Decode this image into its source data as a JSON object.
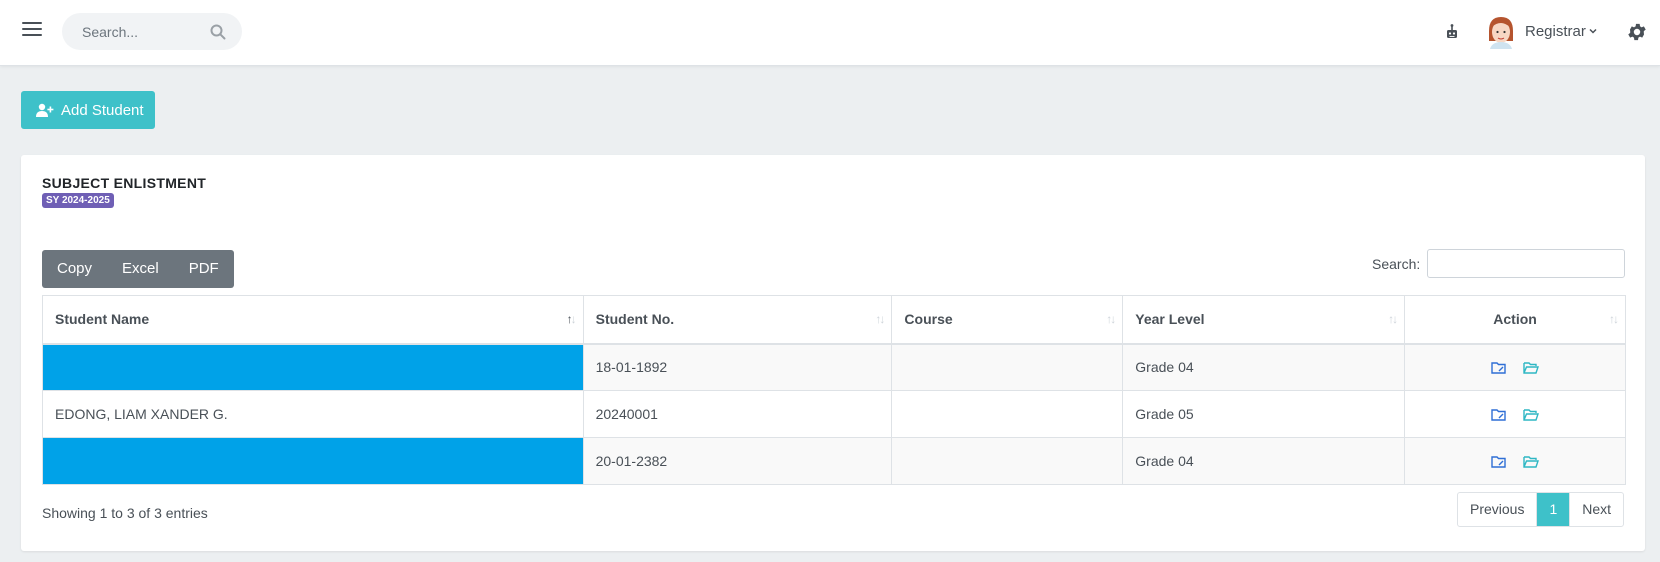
{
  "header": {
    "search_placeholder": "Search...",
    "user_name": "Registrar"
  },
  "actions": {
    "add_student": "Add Student"
  },
  "card": {
    "title": "SUBJECT ENLISTMENT",
    "badge": "SY 2024-2025",
    "export_buttons": [
      "Copy",
      "Excel",
      "PDF"
    ],
    "search_label": "Search:"
  },
  "table": {
    "columns": [
      "Student Name",
      "Student No.",
      "Course",
      "Year Level",
      "Action"
    ],
    "rows": [
      {
        "name": "",
        "student_no": "18-01-1892",
        "course": "",
        "year_level": "Grade 04"
      },
      {
        "name": "EDONG, LIAM XANDER G.",
        "student_no": "20240001",
        "course": "",
        "year_level": "Grade 05"
      },
      {
        "name": "",
        "student_no": "20-01-2382",
        "course": "",
        "year_level": "Grade 04"
      }
    ]
  },
  "footer": {
    "info": "Showing 1 to 3 of 3 entries",
    "prev": "Previous",
    "page": "1",
    "next": "Next"
  },
  "colors": {
    "accent": "#3ec1c9",
    "badge": "#6f5fb5",
    "highlight": "#00a2e8",
    "export_bg": "#6c757d"
  }
}
